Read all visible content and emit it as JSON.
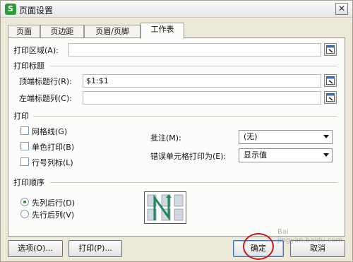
{
  "window": {
    "title": "页面设置",
    "app_icon_glyph": "S",
    "close_glyph": "✕"
  },
  "tabs": [
    {
      "label": "页面"
    },
    {
      "label": "页边距"
    },
    {
      "label": "页眉/页脚"
    },
    {
      "label": "工作表",
      "active": true
    }
  ],
  "print_area": {
    "label": "打印区域(A):",
    "value": ""
  },
  "print_titles": {
    "section_label": "打印标题",
    "top_rows_label": "顶端标题行(R):",
    "top_rows_value": "$1:$1",
    "left_cols_label": "左端标题列(C):",
    "left_cols_value": ""
  },
  "print": {
    "section_label": "打印",
    "gridlines_label": "网格线(G)",
    "mono_label": "单色打印(B)",
    "row_col_headers_label": "行号列标(L)",
    "comments_label": "批注(M):",
    "comments_value": "(无)",
    "errors_label": "错误单元格打印为(E):",
    "errors_value": "显示值"
  },
  "page_order": {
    "section_label": "打印顺序",
    "down_then_over_label": "先列后行(D)",
    "over_then_down_label": "先行后列(V)"
  },
  "buttons": {
    "options": "选项(O)...",
    "print": "打印(P)...",
    "ok": "确定",
    "cancel": "取消"
  },
  "watermark": {
    "line1": "Bai",
    "line2": "jingyan.baidu.com"
  },
  "colors": {
    "highlight_circle": "#c9161b",
    "accent_green": "#2e9a3e"
  }
}
